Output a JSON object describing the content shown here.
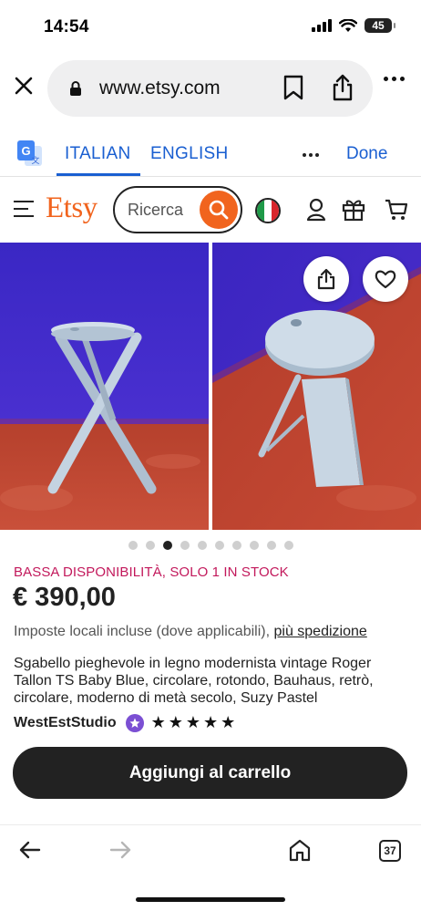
{
  "status": {
    "time": "14:54",
    "battery": "45"
  },
  "browser": {
    "url": "www.etsy.com",
    "icons": [
      "close-icon",
      "lock-icon",
      "bookmark-icon",
      "share-icon",
      "more-icon"
    ]
  },
  "translate_bar": {
    "icon": "google-translate-icon",
    "languages": [
      "ITALIAN",
      "ENGLISH"
    ],
    "active_language": "ITALIAN",
    "done_label": "Done",
    "accent": "#1a5fd1"
  },
  "header": {
    "logo": "Etsy",
    "search_placeholder": "Ricerca",
    "brand_color": "#f1641e",
    "icons": [
      "menu-icon",
      "search-icon",
      "italy-flag-icon",
      "user-icon",
      "gift-icon",
      "cart-icon"
    ]
  },
  "carousel": {
    "image_count": 10,
    "active_index": 2,
    "actions": [
      "share-icon",
      "heart-icon"
    ]
  },
  "product": {
    "stock_notice": "BASSA DISPONIBILITÀ, SOLO 1 IN STOCK",
    "price": "€ 390,00",
    "taxes_text": "Imposte locali incluse (dove applicabili),",
    "shipping_link": "più spedizione",
    "title": "Sgabello pieghevole in legno modernista vintage Roger Tallon TS Baby Blue, circolare, rotondo, Bauhaus, retrò, circolare, moderno di metà secolo, Suzy Pastel",
    "shop_name": "WestEstStudio",
    "rating": 5,
    "stock_color": "#c2185b"
  },
  "cta": {
    "add_to_cart": "Aggiungi al carrello"
  },
  "bottom_nav": {
    "tab_count": "37",
    "icons": [
      "back-arrow-icon",
      "forward-arrow-icon",
      "home-icon",
      "tabs-icon"
    ]
  }
}
